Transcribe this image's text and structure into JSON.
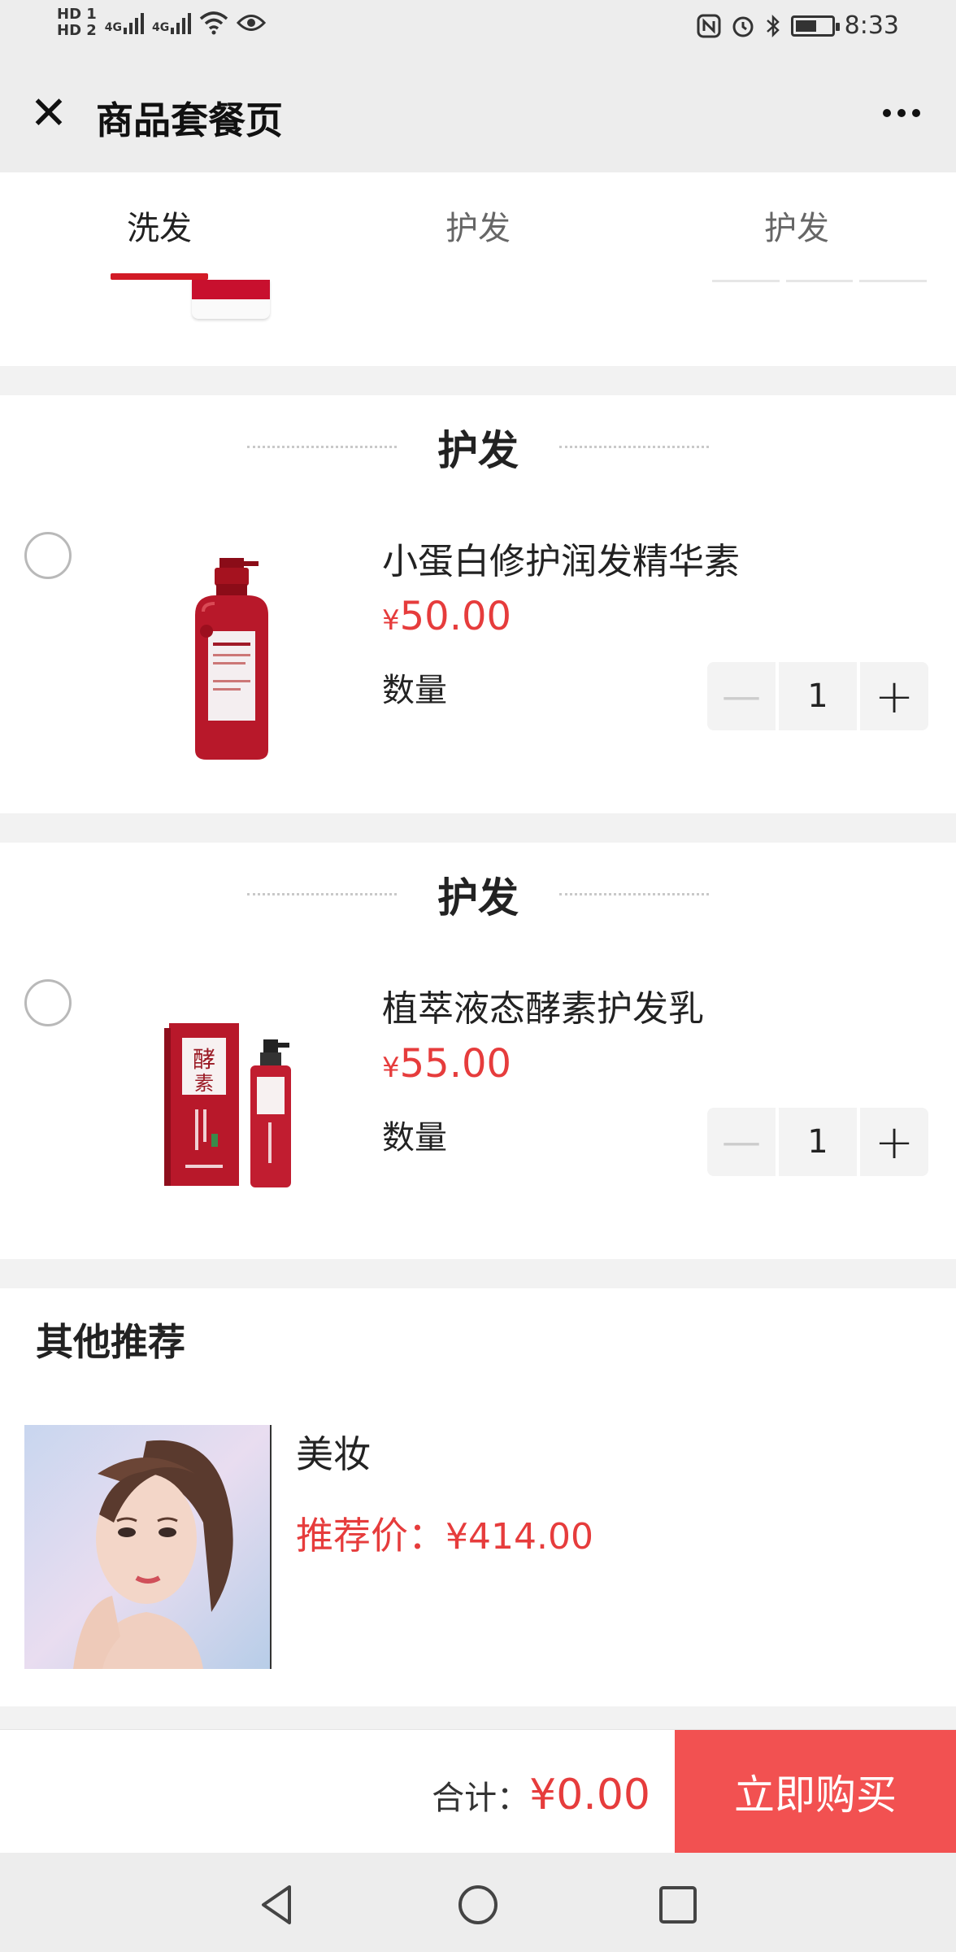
{
  "status_bar": {
    "hd1": "HD 1",
    "hd2": "HD 2",
    "net1": "4G",
    "net2": "4G",
    "time": "8:33",
    "battery_level": 0.6,
    "icons": [
      "nfc-icon",
      "alarm-icon",
      "bluetooth-icon",
      "eye-icon",
      "wifi-icon"
    ]
  },
  "header": {
    "title": "商品套餐页",
    "close_icon": "✕"
  },
  "tabs": [
    {
      "label": "洗发",
      "active": true
    },
    {
      "label": "护发",
      "active": false
    },
    {
      "label": "护发",
      "active": false
    }
  ],
  "sections": [
    {
      "title": "护发",
      "product": {
        "name": "小蛋白修护润发精华素",
        "currency": "¥",
        "price": "50.00",
        "qty_label": "数量",
        "qty": "1"
      }
    },
    {
      "title": "护发",
      "product": {
        "name": "植萃液态酵素护发乳",
        "currency": "¥",
        "price": "55.00",
        "qty_label": "数量",
        "qty": "1"
      }
    }
  ],
  "recommend": {
    "heading": "其他推荐",
    "items": [
      {
        "name": "美妆",
        "price_label": "推荐价：",
        "price": "¥414.00"
      }
    ]
  },
  "footer": {
    "total_label": "合计：",
    "total_value": "¥0.00",
    "buy_label": "立即购买"
  },
  "colors": {
    "accent_red": "#e63c3c",
    "buy_button": "#f25151",
    "tab_indicator": "#d21a26"
  }
}
